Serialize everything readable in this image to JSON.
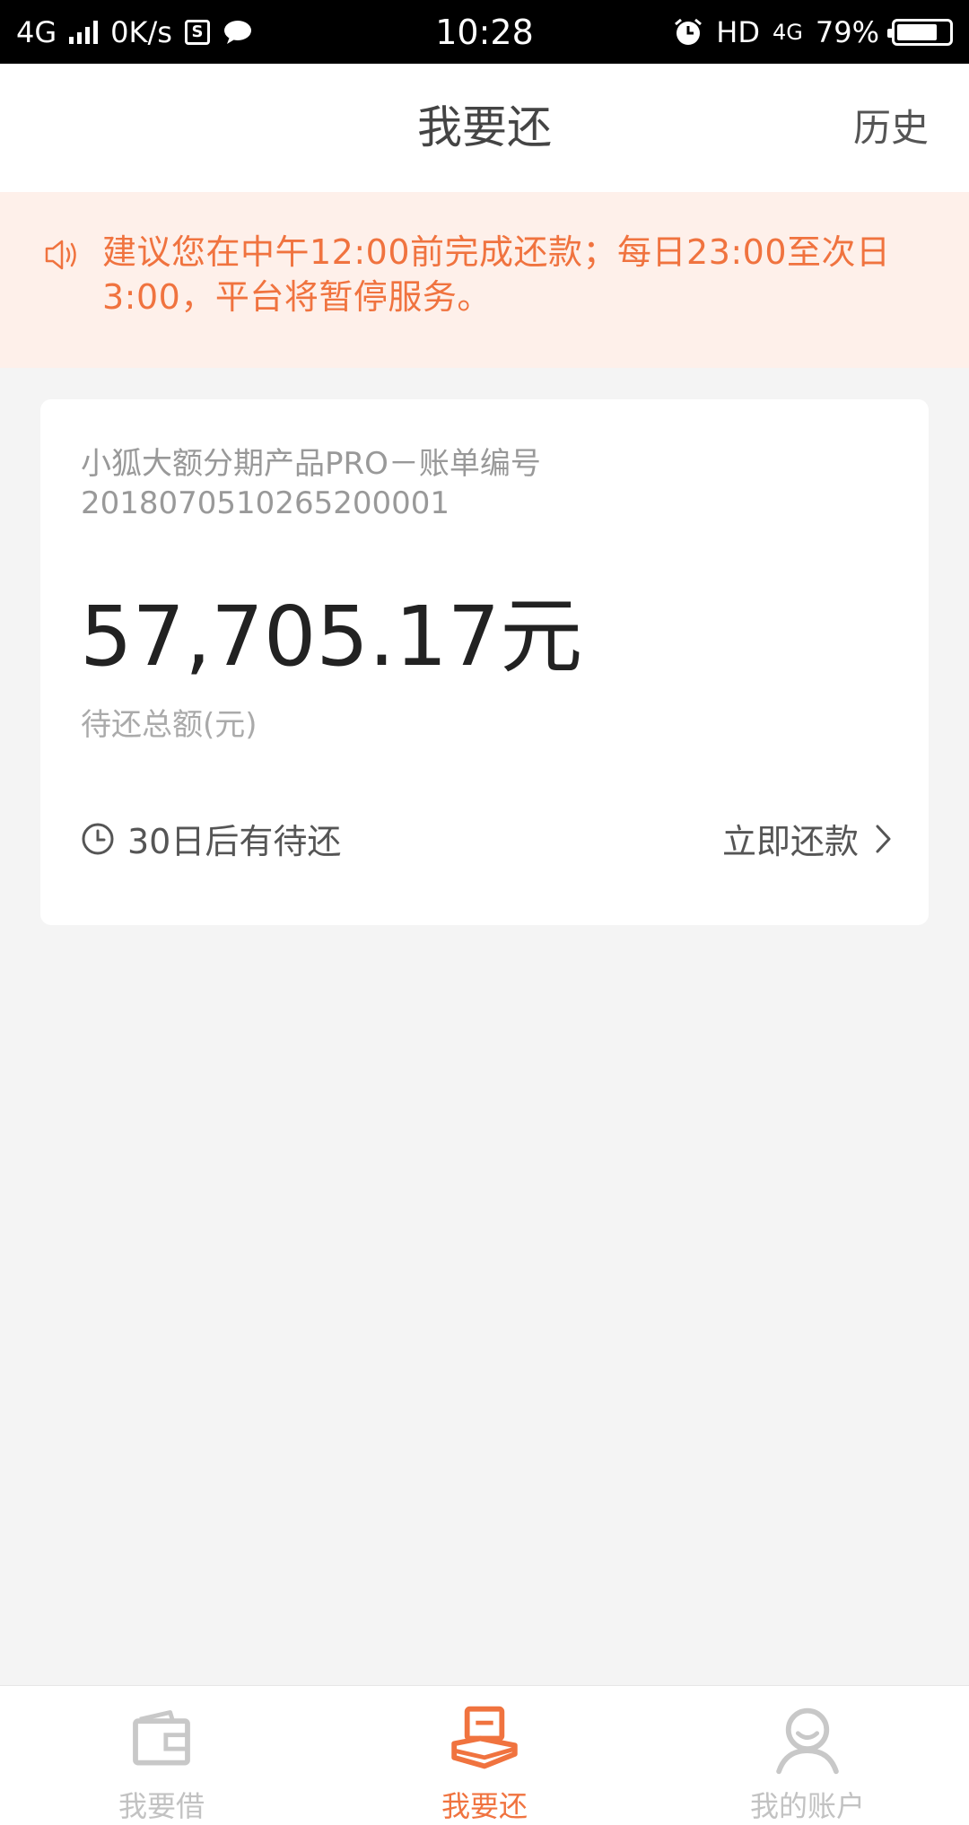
{
  "status_bar": {
    "network": "4G",
    "speed": "0K/s",
    "time": "10:28",
    "hd": "HD",
    "network_right": "4G",
    "battery": "79%",
    "battery_level": 0.79
  },
  "header": {
    "title": "我要还",
    "history": "历史"
  },
  "notice": {
    "text": "建议您在中午12:00前完成还款；每日23:00至次日3:00，平台将暂停服务。",
    "color": "#f0733f"
  },
  "bill": {
    "product": "小狐大额分期产品PRO－账单编号",
    "number": "2018070510265200001",
    "amount": "57,705.17元",
    "amount_label": "待还总额(元)",
    "due_text": "30日后有待还",
    "pay_label": "立即还款"
  },
  "tabs": [
    {
      "label": "我要借",
      "icon": "wallet-icon",
      "active": false
    },
    {
      "label": "我要还",
      "icon": "repay-icon",
      "active": true
    },
    {
      "label": "我的账户",
      "icon": "user-icon",
      "active": false
    }
  ],
  "colors": {
    "accent": "#f0733f",
    "background": "#f4f4f4"
  }
}
